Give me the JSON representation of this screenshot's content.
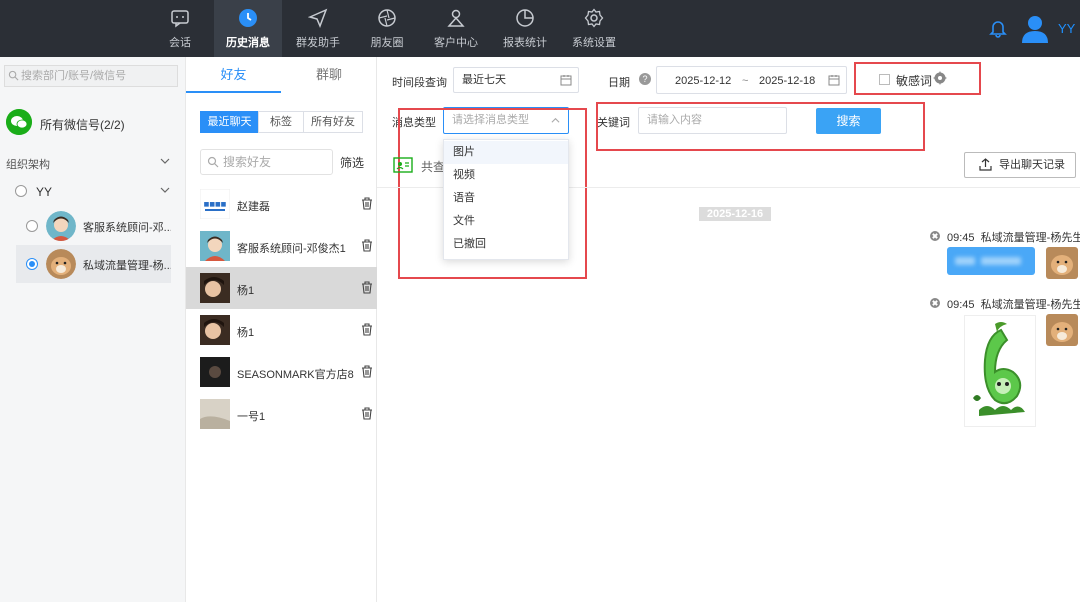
{
  "nav": {
    "items": [
      {
        "label": "会话",
        "icon": "chat-icon"
      },
      {
        "label": "历史消息",
        "icon": "clock-icon",
        "active": true
      },
      {
        "label": "群发助手",
        "icon": "send-icon"
      },
      {
        "label": "朋友圈",
        "icon": "aperture-icon"
      },
      {
        "label": "客户中心",
        "icon": "user-icon"
      },
      {
        "label": "报表统计",
        "icon": "pie-chart-icon"
      },
      {
        "label": "系统设置",
        "icon": "gear-icon"
      }
    ],
    "user_name": "YY"
  },
  "left": {
    "search_placeholder": "搜索部门/账号/微信号",
    "all_accounts": "所有微信号(2/2)",
    "org_label": "组织架构",
    "group_name": "YY",
    "accounts": [
      {
        "name": "客服系统顾问-邓..."
      },
      {
        "name": "私域流量管理-杨..."
      }
    ]
  },
  "friends": {
    "tab_friends": "好友",
    "tab_groups": "群聊",
    "segments": [
      "最近聊天",
      "标签",
      "所有好友"
    ],
    "search_placeholder": "搜索好友",
    "filter_label": "筛选",
    "list": [
      {
        "name": "赵建磊"
      },
      {
        "name": "客服系统顾问-邓俊杰1"
      },
      {
        "name": "杨1"
      },
      {
        "name": "杨1"
      },
      {
        "name": "SEASONMARK官方店8"
      },
      {
        "name": "一号1"
      }
    ]
  },
  "filters": {
    "time_label": "时间段查询",
    "time_value": "最近七天",
    "date_label": "日期",
    "date_help": "?",
    "date_start": "2025-12-12",
    "date_sep": "~",
    "date_end": "2025-12-18",
    "sensitive_label": "敏感词",
    "msg_type_label": "消息类型",
    "msg_type_placeholder": "请选择消息类型",
    "keyword_label": "关键词",
    "keyword_placeholder": "请输入内容",
    "search_button": "搜索",
    "msg_type_options": [
      "图片",
      "视频",
      "语音",
      "文件",
      "已撤回"
    ]
  },
  "chat": {
    "share_label": "共查",
    "export_button": "导出聊天记录",
    "date_divider": "2025-12-16",
    "messages": [
      {
        "time": "09:45",
        "sender": "私域流量管理-杨先生"
      },
      {
        "time": "09:45",
        "sender": "私域流量管理-杨先生"
      }
    ]
  },
  "colors": {
    "accent": "#2a8ff7",
    "nav_bg": "#2b2f36",
    "highlight": "#e5484d"
  }
}
